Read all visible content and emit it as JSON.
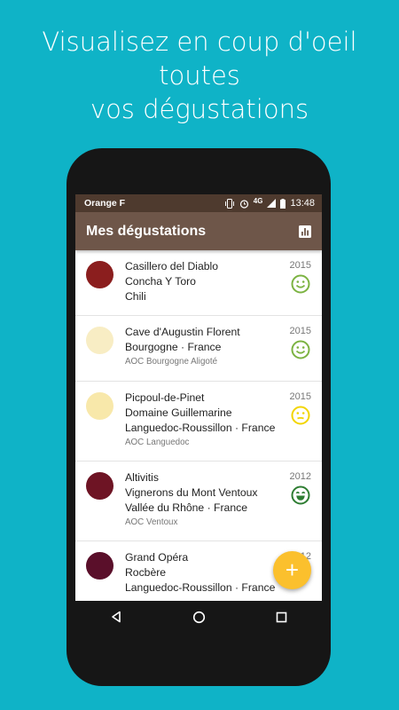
{
  "promo": {
    "line1": "Visualisez en coup d'oeil toutes",
    "line2": "vos dégustations"
  },
  "status_bar": {
    "carrier": "Orange F",
    "network": "4G",
    "time": "13:48"
  },
  "app_bar": {
    "title": "Mes dégustations",
    "stats_icon": "bar-chart-icon"
  },
  "tastings": [
    {
      "name": "Casillero del Diablo",
      "producer": "Concha Y Toro",
      "region": "Chili",
      "appellation": "",
      "year": "2015",
      "color": "#8B1E1E",
      "rating": "happy",
      "rating_color": "#7CB342"
    },
    {
      "name": "Cave d'Augustin Florent",
      "producer": "Bourgogne · France",
      "region": "",
      "appellation": "AOC Bourgogne Aligoté",
      "year": "2015",
      "color": "#F8EDC4",
      "rating": "happy",
      "rating_color": "#7CB342"
    },
    {
      "name": "Picpoul-de-Pinet",
      "producer": "Domaine Guillemarine",
      "region": "Languedoc-Roussillon · France",
      "appellation": "AOC Languedoc",
      "year": "2015",
      "color": "#F8E8AA",
      "rating": "neutral",
      "rating_color": "#F2D500"
    },
    {
      "name": "Altivitis",
      "producer": "Vignerons du Mont Ventoux",
      "region": "Vallée du Rhône · France",
      "appellation": "AOC Ventoux",
      "year": "2012",
      "color": "#6E1424",
      "rating": "very-happy",
      "rating_color": "#2E7D32"
    },
    {
      "name": "Grand Opéra",
      "producer": "Rocbère",
      "region": "Languedoc-Roussillon · France",
      "appellation": "",
      "year": "2012",
      "color": "#5A0F2A",
      "rating": "",
      "rating_color": ""
    }
  ],
  "fab": {
    "label": "+",
    "icon": "add-icon"
  },
  "nav_bar": {
    "back": "back-icon",
    "home": "home-icon",
    "recents": "recents-icon"
  },
  "colors": {
    "background": "#0FB3C7",
    "status_bar": "#4E3A2E",
    "app_bar": "#6E5649",
    "fab": "#FBC02D"
  }
}
